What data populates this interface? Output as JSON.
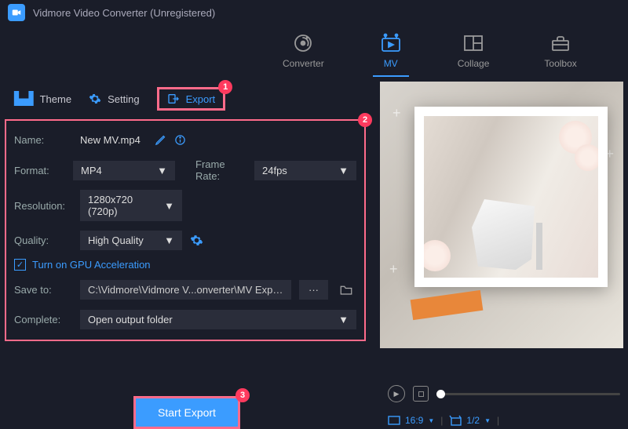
{
  "app": {
    "title": "Vidmore Video Converter (Unregistered)"
  },
  "main_tabs": {
    "converter": "Converter",
    "mv": "MV",
    "collage": "Collage",
    "toolbox": "Toolbox"
  },
  "sub_tabs": {
    "theme": "Theme",
    "setting": "Setting",
    "export": "Export"
  },
  "annotations": {
    "a1": "1",
    "a2": "2",
    "a3": "3"
  },
  "form": {
    "name_label": "Name:",
    "name_value": "New MV.mp4",
    "format_label": "Format:",
    "format_value": "MP4",
    "frame_rate_label": "Frame Rate:",
    "frame_rate_value": "24fps",
    "resolution_label": "Resolution:",
    "resolution_value": "1280x720 (720p)",
    "quality_label": "Quality:",
    "quality_value": "High Quality",
    "gpu_label": "Turn on GPU Acceleration",
    "save_to_label": "Save to:",
    "save_to_path": "C:\\Vidmore\\Vidmore V...onverter\\MV Exported",
    "dots": "···",
    "complete_label": "Complete:",
    "complete_value": "Open output folder"
  },
  "actions": {
    "start_export": "Start Export"
  },
  "player": {
    "aspect": "16:9",
    "scale": "1/2"
  }
}
